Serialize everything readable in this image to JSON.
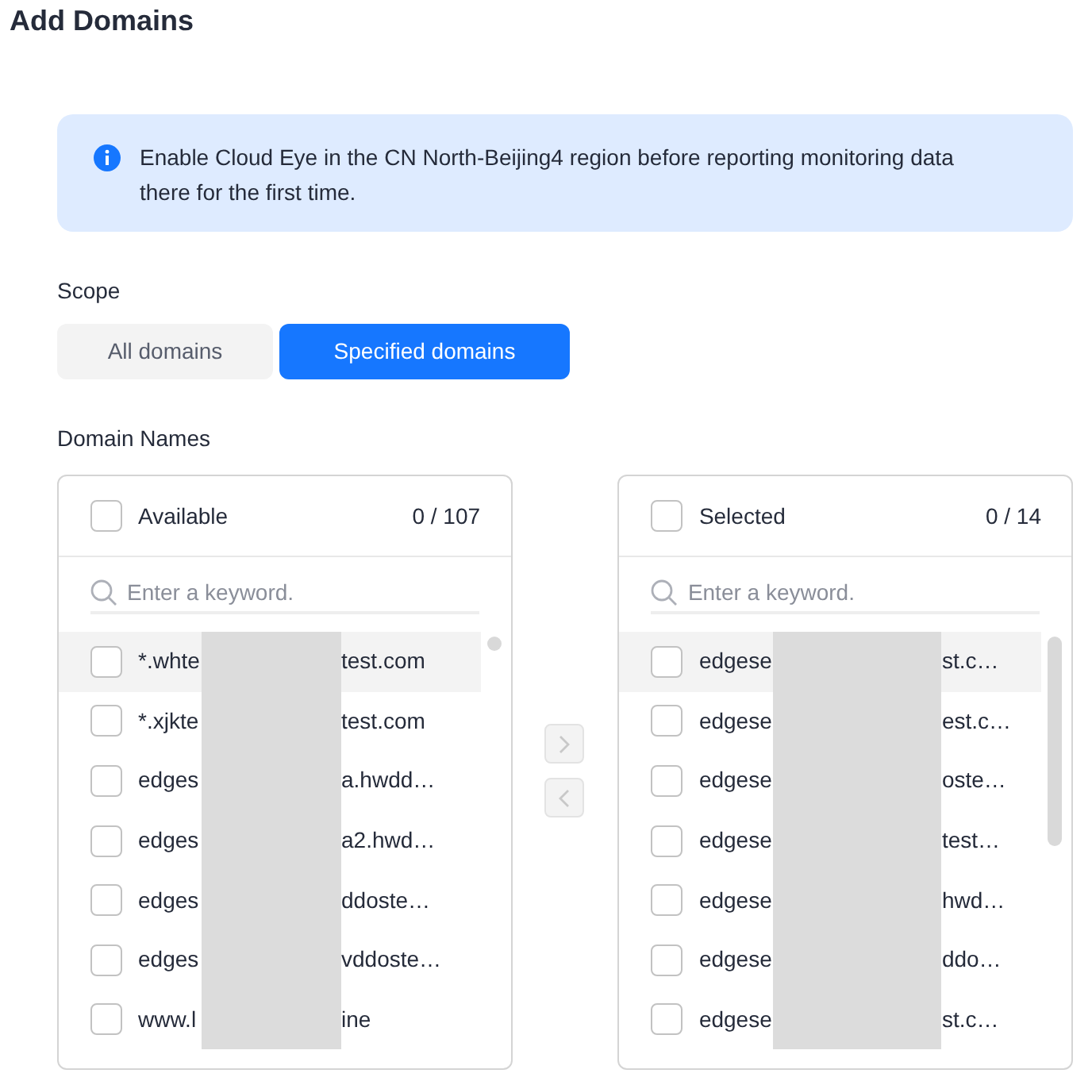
{
  "title": "Add Domains",
  "notice": "Enable Cloud Eye in the CN North-Beijing4 region before reporting monitoring data there for the first time.",
  "scope": {
    "label": "Scope",
    "options": [
      {
        "label": "All domains",
        "selected": false
      },
      {
        "label": "Specified domains",
        "selected": true
      }
    ]
  },
  "domain_names_label": "Domain Names",
  "panels": [
    {
      "title": "Available",
      "checked": false,
      "count": "0 / 107",
      "search_placeholder": "Enter a keyword.",
      "items": [
        {
          "start": "*.whte",
          "end": "test.com",
          "checked": false,
          "highlighted": true
        },
        {
          "start": "*.xjkte",
          "end": "test.com",
          "checked": false,
          "highlighted": false
        },
        {
          "start": "edges",
          "end": "a.hwdd…",
          "checked": false,
          "highlighted": false
        },
        {
          "start": "edges",
          "end": "a2.hwd…",
          "checked": false,
          "highlighted": false
        },
        {
          "start": "edges",
          "end": "ddoste…",
          "checked": false,
          "highlighted": false
        },
        {
          "start": "edges",
          "end": "vddoste…",
          "checked": false,
          "highlighted": false
        },
        {
          "start": "www.l",
          "end": "ine",
          "checked": false,
          "highlighted": false
        }
      ]
    },
    {
      "title": "Selected",
      "checked": false,
      "count": "0 / 14",
      "search_placeholder": "Enter a keyword.",
      "items": [
        {
          "start": "edgese",
          "end": "st.c…",
          "checked": false,
          "highlighted": true
        },
        {
          "start": "edgese",
          "end": "est.c…",
          "checked": false,
          "highlighted": false
        },
        {
          "start": "edgese",
          "end": "oste…",
          "checked": false,
          "highlighted": false
        },
        {
          "start": "edgese",
          "end": "test…",
          "checked": false,
          "highlighted": false
        },
        {
          "start": "edgese",
          "end": "hwd…",
          "checked": false,
          "highlighted": false
        },
        {
          "start": "edgese",
          "end": "ddo…",
          "checked": false,
          "highlighted": false
        },
        {
          "start": "edgese",
          "end": "st.c…",
          "checked": false,
          "highlighted": false
        }
      ]
    }
  ],
  "transfer_buttons": [
    {
      "kind": "right",
      "disabled": true
    },
    {
      "kind": "left",
      "disabled": true
    }
  ]
}
